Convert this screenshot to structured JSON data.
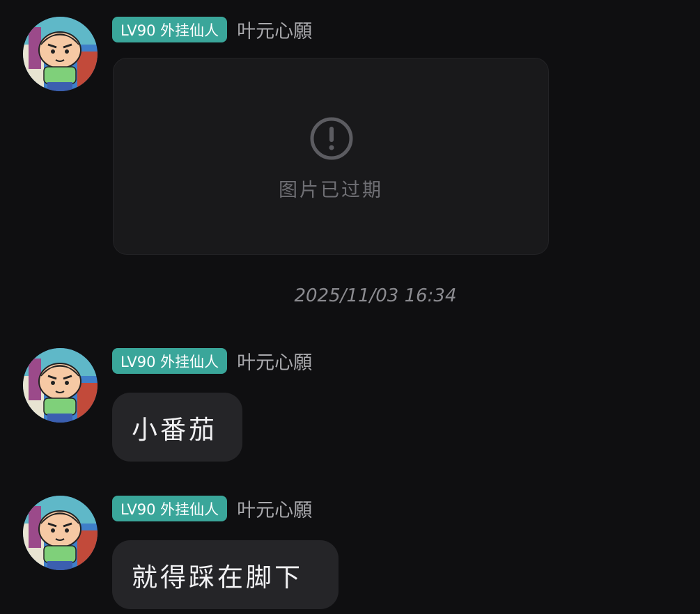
{
  "messages": [
    {
      "badge": "LV90 外挂仙人",
      "nickname": "叶元心願",
      "type": "image",
      "image_status": "图片已过期"
    },
    {
      "badge": "LV90 外挂仙人",
      "nickname": "叶元心願",
      "type": "text",
      "text": "小番茄"
    },
    {
      "badge": "LV90 外挂仙人",
      "nickname": "叶元心願",
      "type": "text",
      "text": "就得踩在脚下"
    }
  ],
  "timestamp": "2025/11/03 16:34",
  "colors": {
    "background": "#0f0f11",
    "badge": "#3aa69a",
    "bubble": "#252528",
    "image_card": "#19191b"
  },
  "icons": {
    "avatar": "cartoon-boy-avatar",
    "expired": "exclamation-circle-icon"
  }
}
